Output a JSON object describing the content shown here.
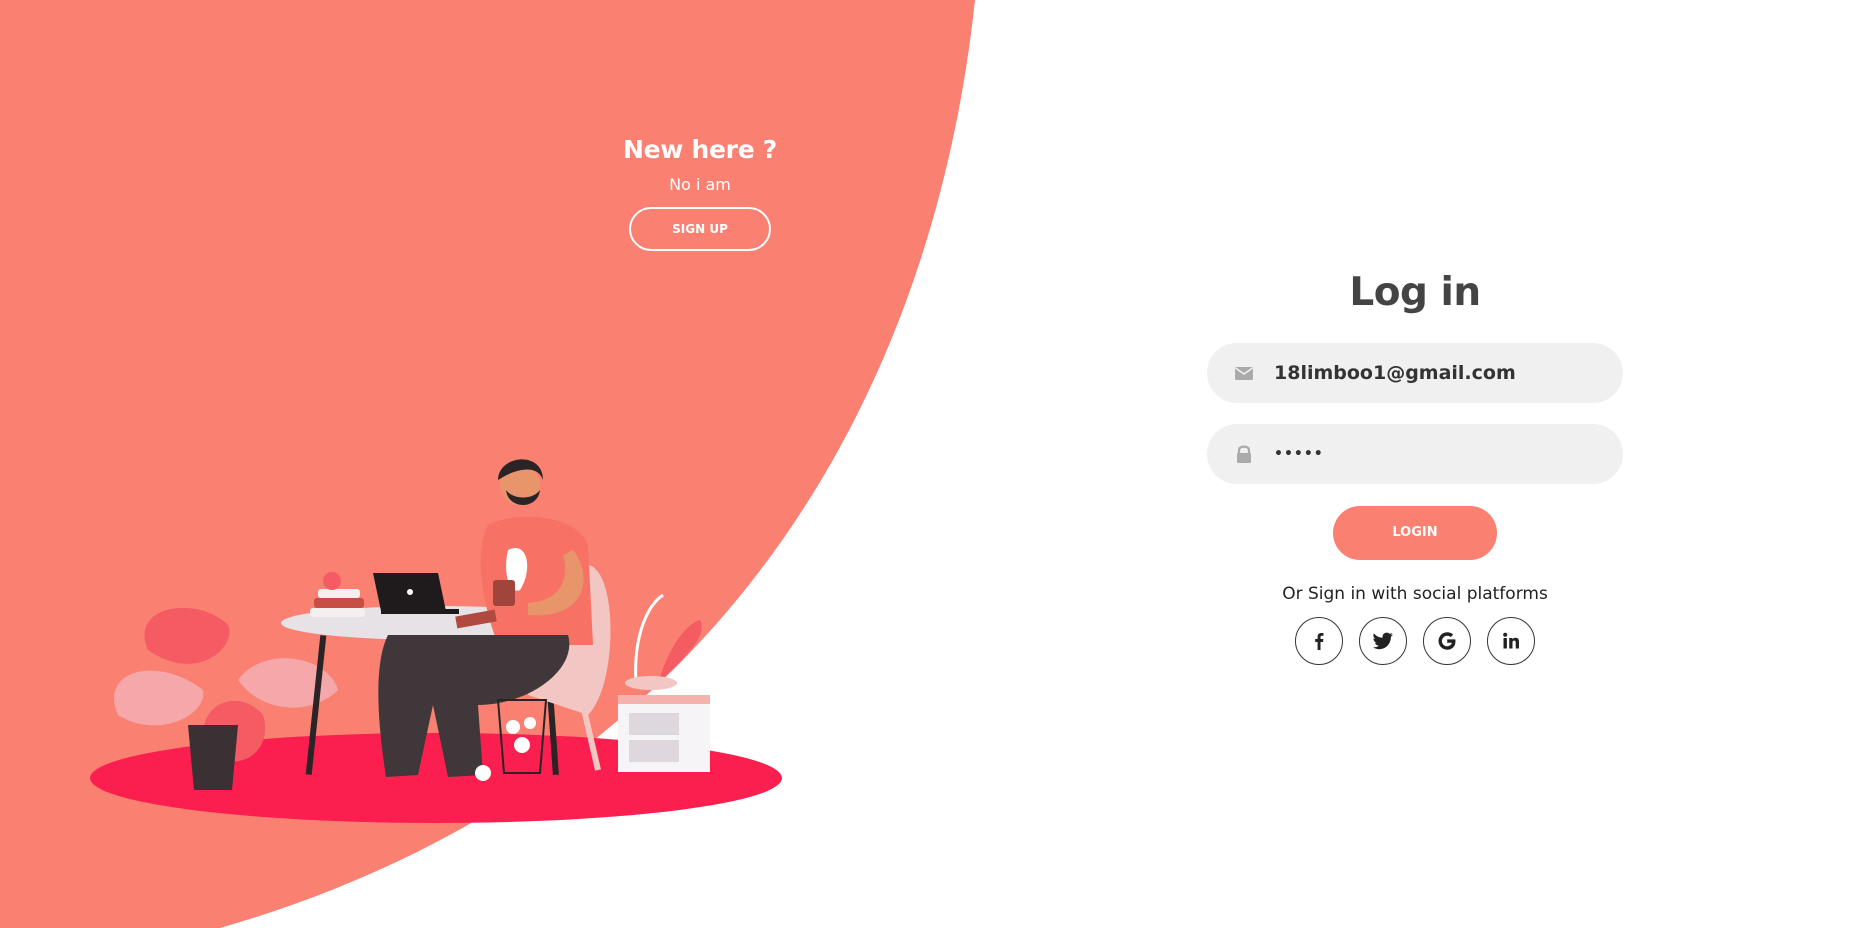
{
  "colors": {
    "accent": "#fa8072",
    "rug": "#fb1f4f",
    "field_bg": "#f0f0f0",
    "title_text": "#444444"
  },
  "left_panel": {
    "title": "New here ?",
    "subtitle": "No i am",
    "signup_label": "SIGN UP"
  },
  "login_form": {
    "title": "Log in",
    "email_value": "18limboo1@gmail.com",
    "email_icon": "envelope-icon",
    "password_value": "•••••",
    "password_icon": "lock-icon",
    "login_label": "LOGIN",
    "social_text": "Or Sign in with social platforms",
    "social": [
      {
        "icon": "facebook-icon",
        "glyph": "f"
      },
      {
        "icon": "twitter-icon",
        "glyph": "t"
      },
      {
        "icon": "google-icon",
        "glyph": "G"
      },
      {
        "icon": "linkedin-icon",
        "glyph": "in"
      }
    ]
  }
}
